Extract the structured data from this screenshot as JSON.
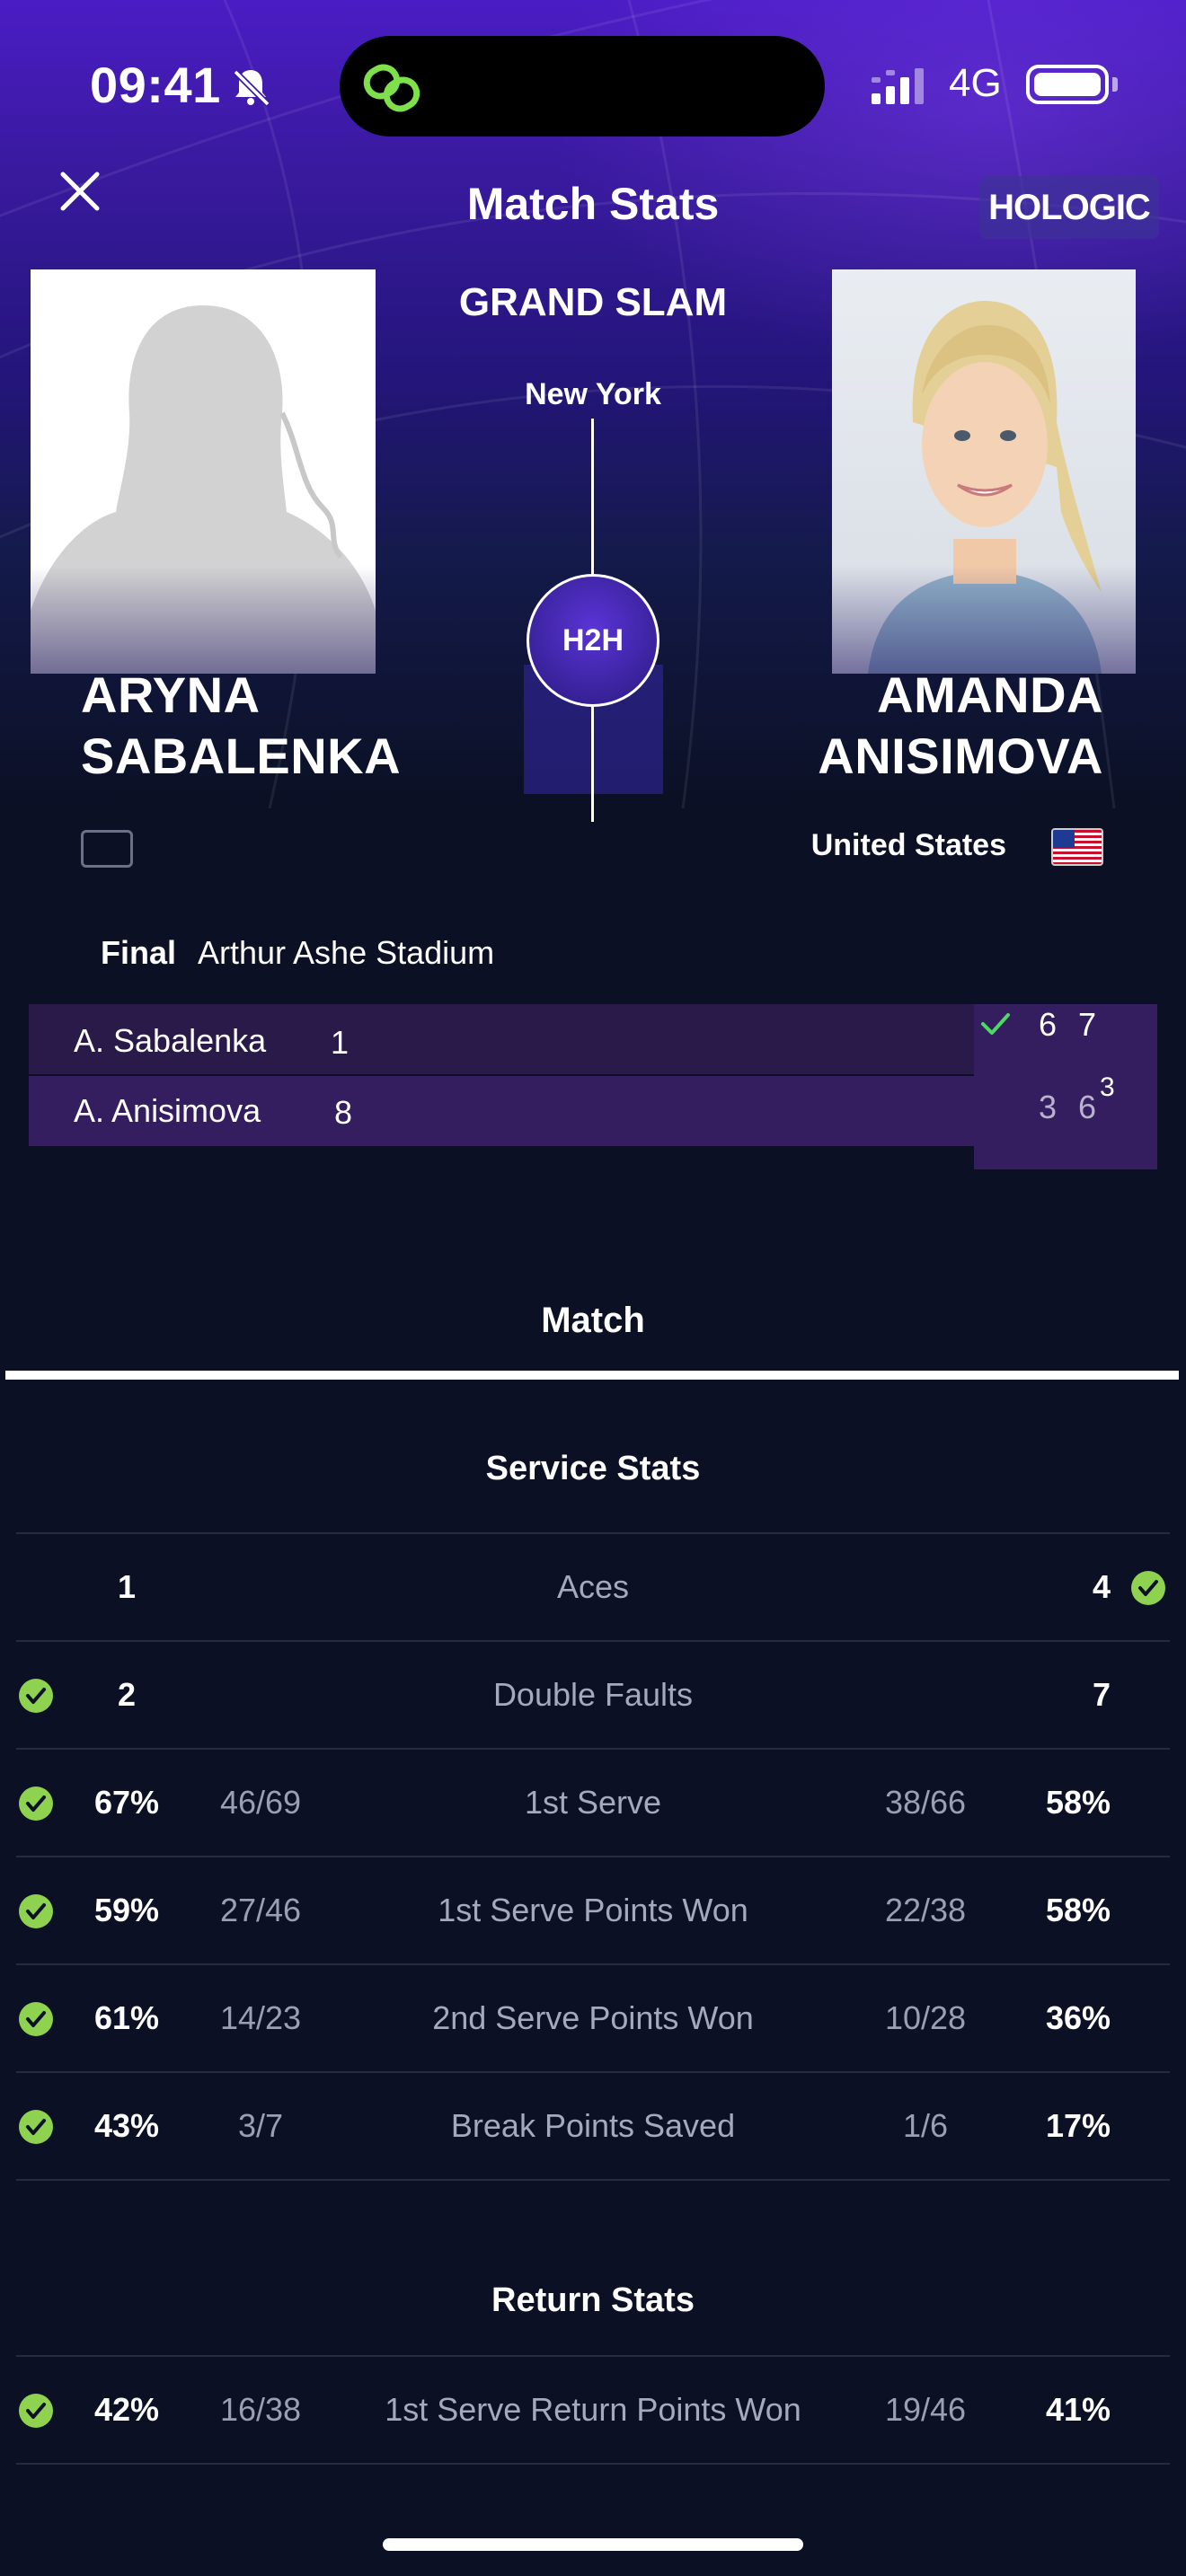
{
  "status_bar": {
    "time": "09:41",
    "network": "4G",
    "icons": [
      "bell-slash-icon",
      "link-app-icon",
      "signal-icon",
      "battery-icon"
    ]
  },
  "header": {
    "title": "Match Stats",
    "close_icon": "close-icon",
    "sponsor": "HOLOGIC"
  },
  "event": {
    "tournament": "GRAND SLAM",
    "city": "New York",
    "h2h_label": "H2H"
  },
  "players": {
    "left": {
      "first": "ARYNA",
      "last": "SABALENKA",
      "country": ""
    },
    "right": {
      "first": "AMANDA",
      "last": "ANISIMOVA",
      "country": "United States"
    }
  },
  "match": {
    "round": "Final",
    "venue": "Arthur Ashe Stadium",
    "rows": [
      {
        "name": "A. Sabalenka",
        "seed": "1",
        "sets": [
          "6",
          "7"
        ],
        "tiebreak": "",
        "winner": true
      },
      {
        "name": "A. Anisimova",
        "seed": "8",
        "sets": [
          "3",
          "6"
        ],
        "tiebreak": "3",
        "winner": false
      }
    ]
  },
  "tabs": {
    "match": "Match"
  },
  "service_stats": {
    "title": "Service Stats",
    "rows": [
      {
        "label": "Aces",
        "left_value": "1",
        "left_ratio": "",
        "right_ratio": "",
        "right_value": "4",
        "leader": "right"
      },
      {
        "label": "Double Faults",
        "left_value": "2",
        "left_ratio": "",
        "right_ratio": "",
        "right_value": "7",
        "leader": "left"
      },
      {
        "label": "1st Serve",
        "left_value": "67%",
        "left_ratio": "46/69",
        "right_ratio": "38/66",
        "right_value": "58%",
        "leader": "left"
      },
      {
        "label": "1st Serve Points Won",
        "left_value": "59%",
        "left_ratio": "27/46",
        "right_ratio": "22/38",
        "right_value": "58%",
        "leader": "left"
      },
      {
        "label": "2nd Serve Points Won",
        "left_value": "61%",
        "left_ratio": "14/23",
        "right_ratio": "10/28",
        "right_value": "36%",
        "leader": "left"
      },
      {
        "label": "Break Points Saved",
        "left_value": "43%",
        "left_ratio": "3/7",
        "right_ratio": "1/6",
        "right_value": "17%",
        "leader": "left"
      }
    ]
  },
  "return_stats": {
    "title": "Return Stats",
    "rows": [
      {
        "label": "1st Serve Return Points Won",
        "left_value": "42%",
        "left_ratio": "16/38",
        "right_ratio": "19/46",
        "right_value": "41%",
        "leader": "left"
      }
    ]
  },
  "colors": {
    "accent_green": "#8ed24f",
    "win_check": "#4cd964",
    "background": "#0b1024",
    "hero_purple": "#4a1cc4"
  }
}
